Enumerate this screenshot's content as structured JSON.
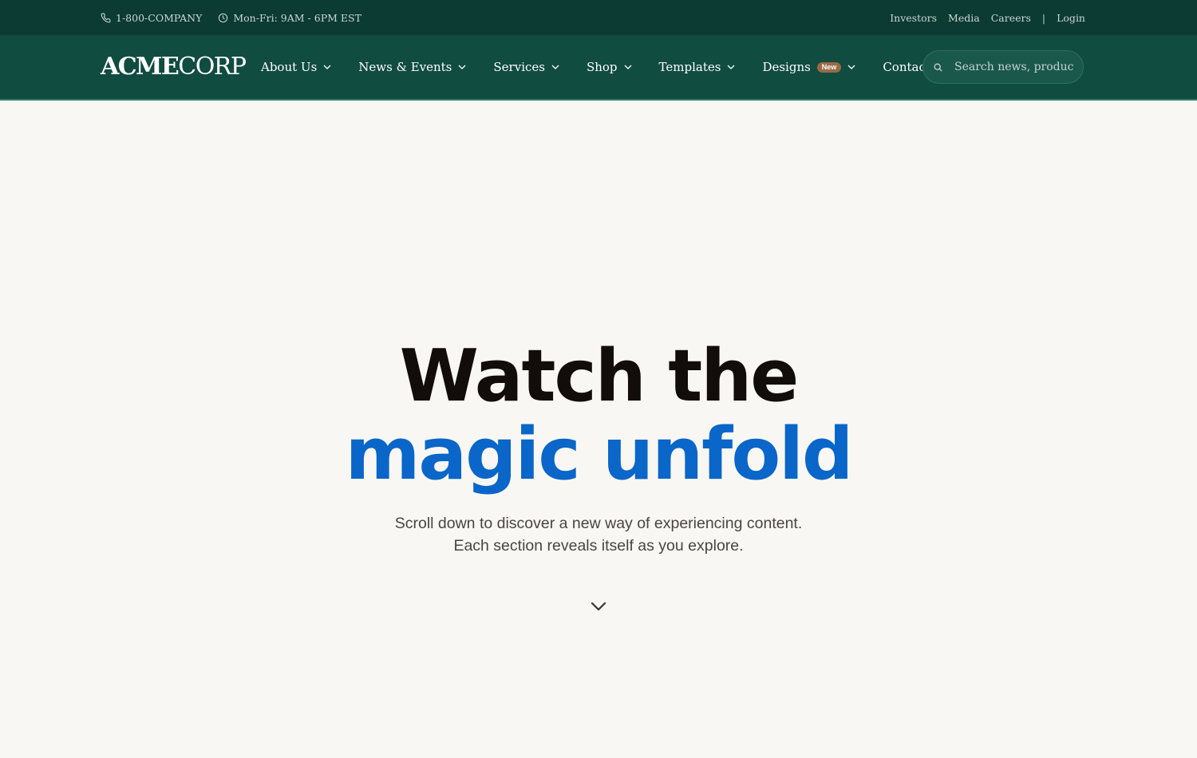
{
  "topbar": {
    "phone": "1-800-COMPANY",
    "hours": "Mon-Fri: 9AM - 6PM EST",
    "links": [
      "Investors",
      "Media",
      "Careers"
    ],
    "divider": "|",
    "login": "Login"
  },
  "nav": {
    "logo_bold": "ACME",
    "logo_rest": "CORP",
    "items": [
      {
        "label": "About Us"
      },
      {
        "label": "News & Events"
      },
      {
        "label": "Services"
      },
      {
        "label": "Shop"
      },
      {
        "label": "Templates"
      },
      {
        "label": "Designs",
        "badge": "New"
      },
      {
        "label": "Contact"
      }
    ],
    "search_placeholder": "Search news, products..."
  },
  "hero": {
    "line1": "Watch the",
    "line2": "magic unfold",
    "sub_line1": "Scroll down to discover a new way of experiencing content.",
    "sub_line2": "Each section reveals itself as you explore."
  },
  "icons": {
    "phone": "phone-icon",
    "clock": "clock-icon",
    "search": "search-icon",
    "chevron": "chevron-down-icon",
    "scroll": "scroll-down-icon"
  },
  "colors": {
    "topbar_bg": "#0b3b33",
    "nav_bg": "#114c40",
    "badge": "#9a6a45",
    "headline_dark": "#120d0a",
    "headline_accent": "#0a66c9",
    "page_bg": "#f8f7f4"
  }
}
